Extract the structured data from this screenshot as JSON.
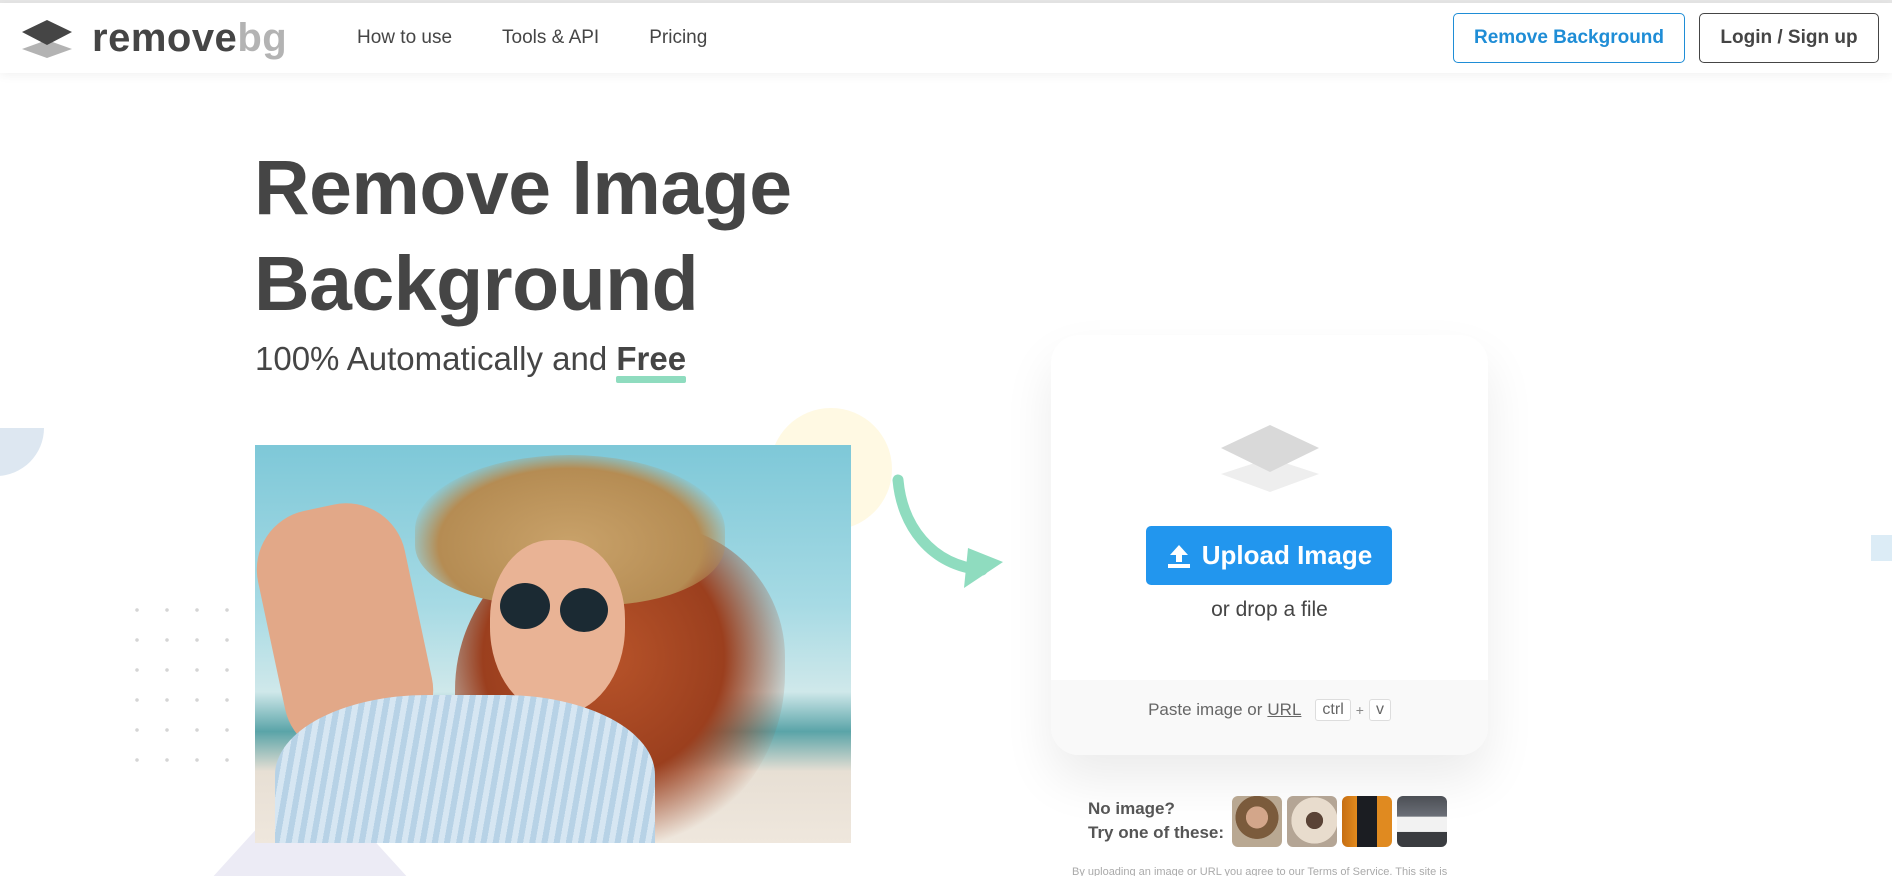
{
  "app": {
    "logo_remove": "remove",
    "logo_bg": "bg"
  },
  "nav": {
    "items": [
      "How to use",
      "Tools & API",
      "Pricing"
    ],
    "remove_background_label": "Remove Background",
    "login_label": "Login / Sign up"
  },
  "hero": {
    "title_line1": "Remove Image",
    "title_line2": "Background",
    "subtitle_prefix": "100% Automatically and ",
    "subtitle_emphasis": "Free"
  },
  "upload": {
    "button_label": "Upload Image",
    "drop_text": "or drop a file",
    "paste_text": "Paste image or",
    "url_link": "URL",
    "key_ctrl": "ctrl",
    "key_plus": "+",
    "key_v": "v"
  },
  "samples": {
    "line1": "No image?",
    "line2": "Try one of these:"
  },
  "footer": {
    "tiny_text": "By uploading an image or URL you agree to our Terms of Service. This site is"
  },
  "colors": {
    "accent_blue": "#2296ee",
    "text_dark": "#454545",
    "logo_grey": "#b3b3b3",
    "free_underline": "#8fdcbf",
    "arrow_green": "#8fdcbf"
  },
  "icons": [
    "logo-layers-icon",
    "upload-icon",
    "layers-icon",
    "curved-arrow-icon"
  ]
}
